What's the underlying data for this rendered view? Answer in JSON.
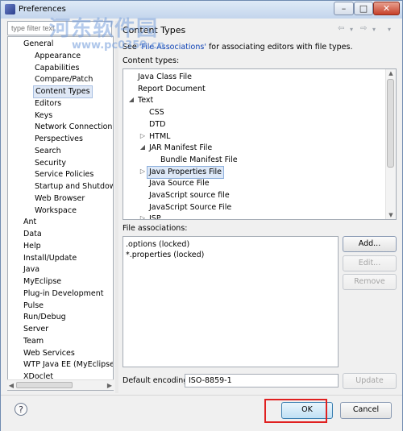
{
  "window": {
    "title": "Preferences",
    "minimize_glyph": "–",
    "maximize_glyph": "□",
    "close_glyph": "✕"
  },
  "watermark": {
    "text": "河东软件园",
    "url": "www.pc0359.cn"
  },
  "sidebar": {
    "filter_placeholder": "type filter text",
    "items": [
      {
        "label": "General",
        "indent": 1
      },
      {
        "label": "Appearance",
        "indent": 2
      },
      {
        "label": "Capabilities",
        "indent": 2
      },
      {
        "label": "Compare/Patch",
        "indent": 2
      },
      {
        "label": "Content Types",
        "indent": 2,
        "selected": true
      },
      {
        "label": "Editors",
        "indent": 2
      },
      {
        "label": "Keys",
        "indent": 2
      },
      {
        "label": "Network Connections",
        "indent": 2
      },
      {
        "label": "Perspectives",
        "indent": 2
      },
      {
        "label": "Search",
        "indent": 2
      },
      {
        "label": "Security",
        "indent": 2
      },
      {
        "label": "Service Policies",
        "indent": 2
      },
      {
        "label": "Startup and Shutdown",
        "indent": 2
      },
      {
        "label": "Web Browser",
        "indent": 2
      },
      {
        "label": "Workspace",
        "indent": 2
      },
      {
        "label": "Ant",
        "indent": 1
      },
      {
        "label": "Data",
        "indent": 1
      },
      {
        "label": "Help",
        "indent": 1
      },
      {
        "label": "Install/Update",
        "indent": 1
      },
      {
        "label": "Java",
        "indent": 1
      },
      {
        "label": "MyEclipse",
        "indent": 1
      },
      {
        "label": "Plug-in Development",
        "indent": 1
      },
      {
        "label": "Pulse",
        "indent": 1
      },
      {
        "label": "Run/Debug",
        "indent": 1
      },
      {
        "label": "Server",
        "indent": 1
      },
      {
        "label": "Team",
        "indent": 1
      },
      {
        "label": "Web Services",
        "indent": 1
      },
      {
        "label": "WTP Java EE (MyEclipse)",
        "indent": 1
      },
      {
        "label": "XDoclet",
        "indent": 1
      }
    ]
  },
  "page": {
    "title": "Content Types",
    "nav": {
      "back": "⇦",
      "back_menu": "▾",
      "forward": "⇨",
      "forward_menu": "▾",
      "menu": "▾"
    },
    "description_prefix": "See ",
    "description_link": "'File Associations'",
    "description_suffix": " for associating editors with file types.",
    "content_types_label": "Content types:",
    "content_types": [
      {
        "label": "Java Class File",
        "indent": 0
      },
      {
        "label": "Report Document",
        "indent": 0
      },
      {
        "label": "Text",
        "indent": 0,
        "twisty": "◢"
      },
      {
        "label": "CSS",
        "indent": 1
      },
      {
        "label": "DTD",
        "indent": 1
      },
      {
        "label": "HTML",
        "indent": 1,
        "twisty": "▷"
      },
      {
        "label": "JAR Manifest File",
        "indent": 1,
        "twisty": "◢"
      },
      {
        "label": "Bundle Manifest File",
        "indent": 2
      },
      {
        "label": "Java Properties File",
        "indent": 1,
        "twisty": "▷",
        "selected": true
      },
      {
        "label": "Java Source File",
        "indent": 1
      },
      {
        "label": "JavaScript source file",
        "indent": 1
      },
      {
        "label": "JavaScript Source File",
        "indent": 1
      },
      {
        "label": "JSP",
        "indent": 1,
        "twisty": "▷"
      }
    ],
    "file_associations_label": "File associations:",
    "file_associations": [
      ".options (locked)",
      "*.properties (locked)"
    ],
    "buttons": {
      "add": "Add...",
      "edit": "Edit...",
      "remove": "Remove",
      "update": "Update"
    },
    "encoding_label": "Default encoding:",
    "encoding_value": "ISO-8859-1"
  },
  "footer": {
    "help_glyph": "?",
    "ok": "OK",
    "cancel": "Cancel"
  },
  "colors": {
    "highlight": "#e02020",
    "link": "#0b3fb3",
    "selection": "#dde8f7"
  }
}
